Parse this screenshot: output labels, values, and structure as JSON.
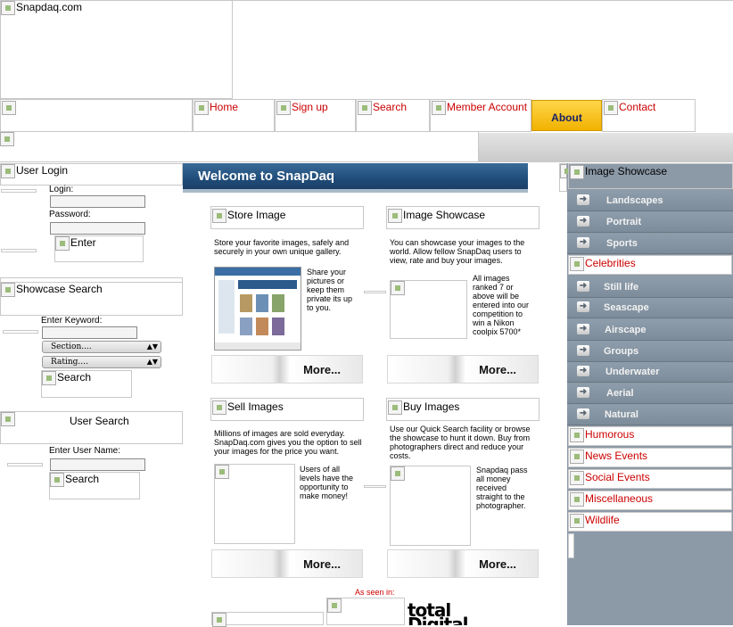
{
  "header": {
    "logo_alt": "Snapdaq.com"
  },
  "nav": {
    "home": "Home",
    "signup": "Sign up",
    "search": "Search",
    "member_account": "Member Account",
    "about": "About",
    "contact": "Contact"
  },
  "login": {
    "title": "User Login",
    "login_label": "Login:",
    "password_label": "Password:",
    "enter_button": "Enter"
  },
  "showcase_search": {
    "title": "Showcase Search",
    "keyword_label": "Enter Keyword:",
    "section_select": "Section....",
    "rating_select": "Rating....",
    "search_button": "Search"
  },
  "user_search": {
    "title": "User Search",
    "username_label": "Enter User Name:",
    "search_button": "Search"
  },
  "welcome": {
    "title": "Welcome to SnapDaq"
  },
  "panels": {
    "store": {
      "title": "Store Image",
      "text": "Store your favorite images, safely and securely in your own unique gallery.",
      "side_text": "Share your pictures or keep them private its up to you.",
      "more": "More..."
    },
    "showcase": {
      "title": "Image Showcase",
      "text": "You can showcase your images to the world. Allow fellow SnapDaq users to view, rate and buy your images.",
      "side_text": "All images ranked 7 or above will be entered into our competition to win a Nikon coolpix 5700*",
      "more": "More..."
    },
    "sell": {
      "title": "Sell Images",
      "text": "Millions of images are sold everyday. SnapDaq.com gives you the option to sell your images for the price you want.",
      "side_text": "Users of all levels have the opportunity to make money!",
      "more": "More..."
    },
    "buy": {
      "title": "Buy Images",
      "text": "Use our Quick Search facility or browse the showcase to hunt it down. Buy from photographers direct and reduce your costs.",
      "side_text": "Snapdaq pass all money received straight to the photographer.",
      "more": "More..."
    }
  },
  "as_seen_in": {
    "label": "As seen in:",
    "brand": "total Digital"
  },
  "right_sidebar": {
    "title": "Image Showcase",
    "group1": [
      "Landscapes",
      "Portrait",
      "Sports"
    ],
    "celebrities": "Celebrities",
    "group2": [
      "Still life",
      "Seascape",
      "Airscape",
      "Groups",
      "Underwater",
      "Aerial",
      "Natural"
    ],
    "categories": [
      "Humorous",
      "News Events",
      "Social Events",
      "Miscellaneous",
      "Wildlife"
    ]
  },
  "colors": {
    "accent_red": "#cc0000",
    "about_gold": "#f1b200",
    "sidebar_grey": "#8c9aa8",
    "welcome_blue": "#204d7a"
  }
}
